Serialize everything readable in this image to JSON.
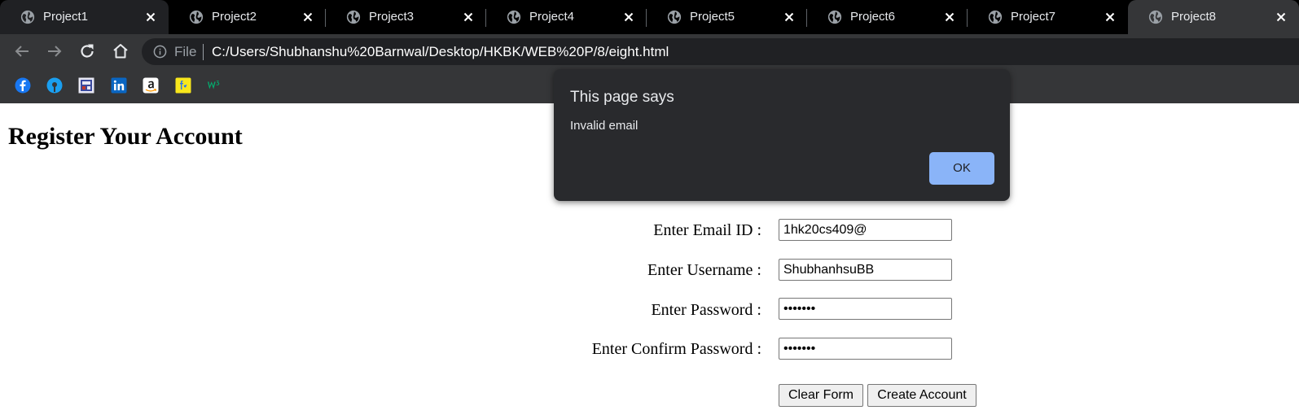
{
  "browser": {
    "tabs": [
      {
        "label": "Project1"
      },
      {
        "label": "Project2"
      },
      {
        "label": "Project3"
      },
      {
        "label": "Project4"
      },
      {
        "label": "Project5"
      },
      {
        "label": "Project6"
      },
      {
        "label": "Project7"
      },
      {
        "label": "Project8"
      }
    ],
    "active_tab": "Project8",
    "address": {
      "scheme_label": "File",
      "url": "C:/Users/Shubhanshu%20Barnwal/Desktop/HKBK/WEB%20P/8/eight.html"
    },
    "bookmarks": [
      {
        "icon": "facebook-icon",
        "color": "#1877f2"
      },
      {
        "icon": "sbi-bank-icon",
        "color": "#1a9ff0"
      },
      {
        "icon": "college-logo-icon",
        "color": "#3b4a9e"
      },
      {
        "icon": "linkedin-icon",
        "color": "#0a66c2"
      },
      {
        "icon": "amazon-icon",
        "color": "#ffffff"
      },
      {
        "icon": "flipkart-icon",
        "color": "#f8e71c"
      },
      {
        "icon": "w3schools-icon",
        "color": "#04aa6d"
      }
    ]
  },
  "page": {
    "heading": "Register Your Account",
    "fields": [
      {
        "label": "Enter Email ID :",
        "value": "1hk20cs409@"
      },
      {
        "label": "Enter Username :",
        "value": "ShubhanhsuBB"
      },
      {
        "label": "Enter Password :",
        "value": "•••••••"
      },
      {
        "label": "Enter Confirm Password :",
        "value": "•••••••"
      }
    ],
    "clear_button": "Clear Form",
    "create_button": "Create Account"
  },
  "dialog": {
    "title": "This page says",
    "message": "Invalid email",
    "ok_label": "OK"
  },
  "colors": {
    "tabstrip_bg": "#000000",
    "toolbar_bg": "#353638",
    "omnibox_bg": "#202124",
    "dialog_bg": "#292a2d",
    "ok_button_bg": "#8ab4f8"
  }
}
